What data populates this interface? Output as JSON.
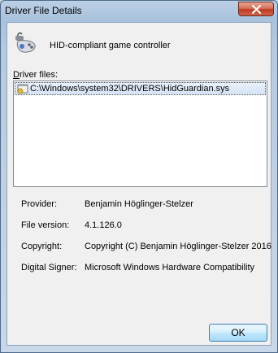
{
  "window": {
    "title": "Driver File Details"
  },
  "device": {
    "name": "HID-compliant game controller",
    "icon": "game-controller-icon"
  },
  "driver_files": {
    "label_prefix": "D",
    "label_rest": "river files:",
    "items": [
      {
        "path": "C:\\Windows\\system32\\DRIVERS\\HidGuardian.sys"
      }
    ]
  },
  "details": {
    "provider": {
      "label": "Provider:",
      "value": "Benjamin Höglinger-Stelzer"
    },
    "file_version": {
      "label": "File version:",
      "value": "4.1.126.0"
    },
    "copyright": {
      "label": "Copyright:",
      "value": "Copyright (C) Benjamin Höglinger-Stelzer 2016"
    },
    "digital_signer": {
      "label": "Digital Signer:",
      "value": "Microsoft Windows Hardware Compatibility"
    }
  },
  "buttons": {
    "ok": "OK"
  },
  "colors": {
    "close_button": "#c13a22",
    "selection": "#d3e3f6",
    "ok_border": "#3c7fb1"
  }
}
